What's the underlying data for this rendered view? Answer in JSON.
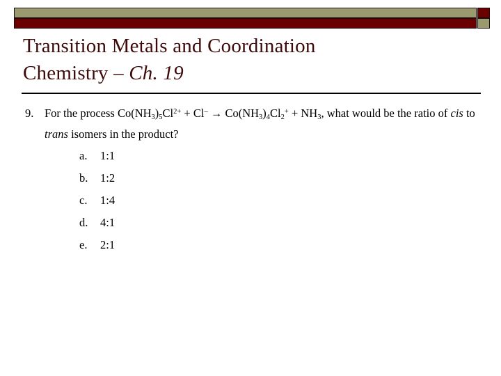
{
  "slide": {
    "title_line1": "Transition Metals and Coordination",
    "title_line2_regular": "Chemistry – ",
    "title_line2_italic": "Ch. 19",
    "title_color": "#3d0a0a",
    "accent_olive": "#9a9a6e",
    "accent_maroon": "#6b0000",
    "divider_color": "#000000",
    "background": "#ffffff"
  },
  "question": {
    "number": "9.",
    "text_part1": "For the process Co(NH",
    "sub_3a": "3",
    "text_part2": ")",
    "sub_5": "5",
    "text_part3": "Cl",
    "sup_2plus": "2+",
    "text_part4": " + Cl",
    "sup_minus": "–",
    "arrow": " → ",
    "text_part5": "Co(NH",
    "sub_3b": "3",
    "text_part6": ")",
    "sub_4": "4",
    "text_part7": "Cl",
    "sub_2": "2",
    "sup_plus": "+",
    "text_part8": " + NH",
    "sub_3c": "3",
    "text_part9": ", what would be the ratio of ",
    "italic_cis": "cis",
    "text_part10": " to ",
    "italic_trans": "trans",
    "text_part11": " isomers in the product?"
  },
  "choices": [
    {
      "letter": "a.",
      "value": "1:1"
    },
    {
      "letter": "b.",
      "value": "1:2"
    },
    {
      "letter": "c.",
      "value": "1:4"
    },
    {
      "letter": "d.",
      "value": "4:1"
    },
    {
      "letter": "e.",
      "value": "2:1"
    }
  ]
}
